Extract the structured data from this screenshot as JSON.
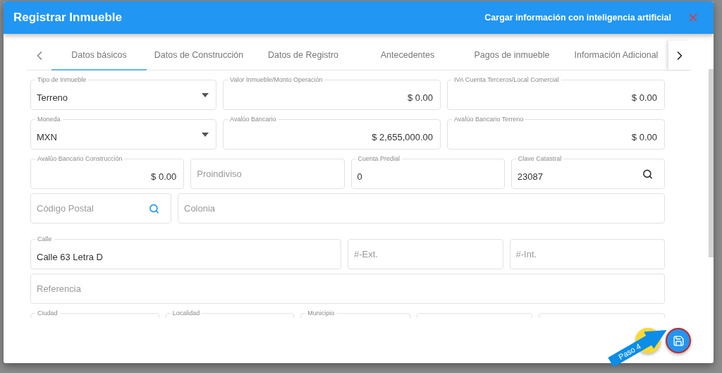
{
  "dialog": {
    "title": "Registrar Inmueble",
    "ai_link": "Cargar información con inteligencia artificial"
  },
  "tabs": [
    {
      "label": "Datos básicos",
      "selected": true
    },
    {
      "label": "Datos de Construcción",
      "selected": false
    },
    {
      "label": "Datos de Registro",
      "selected": false
    },
    {
      "label": "Antecedentes",
      "selected": false
    },
    {
      "label": "Pagos de inmueble",
      "selected": false
    },
    {
      "label": "Información Adicional",
      "selected": false
    }
  ],
  "form_rows": [
    [
      {
        "kind": "select",
        "label": "Tipo de Inmueble",
        "value": "Terreno"
      },
      {
        "kind": "amount",
        "label": "Valor Inmueble/Monto Operación",
        "value": "$ 0.00"
      },
      {
        "kind": "amount",
        "label": "IVA Cuenta Terceros/Local Comercial",
        "value": "$ 0.00"
      }
    ],
    [
      {
        "kind": "select",
        "label": "Moneda",
        "value": "MXN"
      },
      {
        "kind": "amount",
        "label": "Avalúo Bancario",
        "value": "$ 2,655,000.00"
      },
      {
        "kind": "amount",
        "label": "Avalúo Bancario Terreno",
        "value": "$ 0.00"
      }
    ],
    [
      {
        "kind": "amount",
        "label": "Avalúo Bancario Construcción",
        "value": "$ 0.00"
      },
      {
        "kind": "text",
        "placeholder": "Proindiviso"
      },
      {
        "kind": "text",
        "label": "Cuenta Predial",
        "value": "0"
      },
      {
        "kind": "search",
        "label": "Clave Catastral",
        "value": "23087",
        "icon_accent": false
      }
    ],
    [
      {
        "kind": "search",
        "placeholder": "Código Postal",
        "icon_accent": true
      },
      {
        "kind": "text",
        "placeholder": "Colonia"
      }
    ],
    [
      {
        "kind": "text",
        "label": "Calle",
        "value": "Calle 63 Letra D"
      },
      {
        "kind": "text",
        "placeholder": "#-Ext."
      },
      {
        "kind": "text",
        "placeholder": "#-Int."
      }
    ],
    [
      {
        "kind": "text",
        "placeholder": "Referencia"
      }
    ],
    [
      {
        "kind": "text",
        "label": "Ciudad"
      },
      {
        "kind": "text",
        "label": "Localidad"
      },
      {
        "kind": "text",
        "label": "Municipio"
      },
      {
        "kind": "text"
      },
      {
        "kind": "text"
      }
    ]
  ],
  "callout": {
    "text": "Paso 4"
  }
}
